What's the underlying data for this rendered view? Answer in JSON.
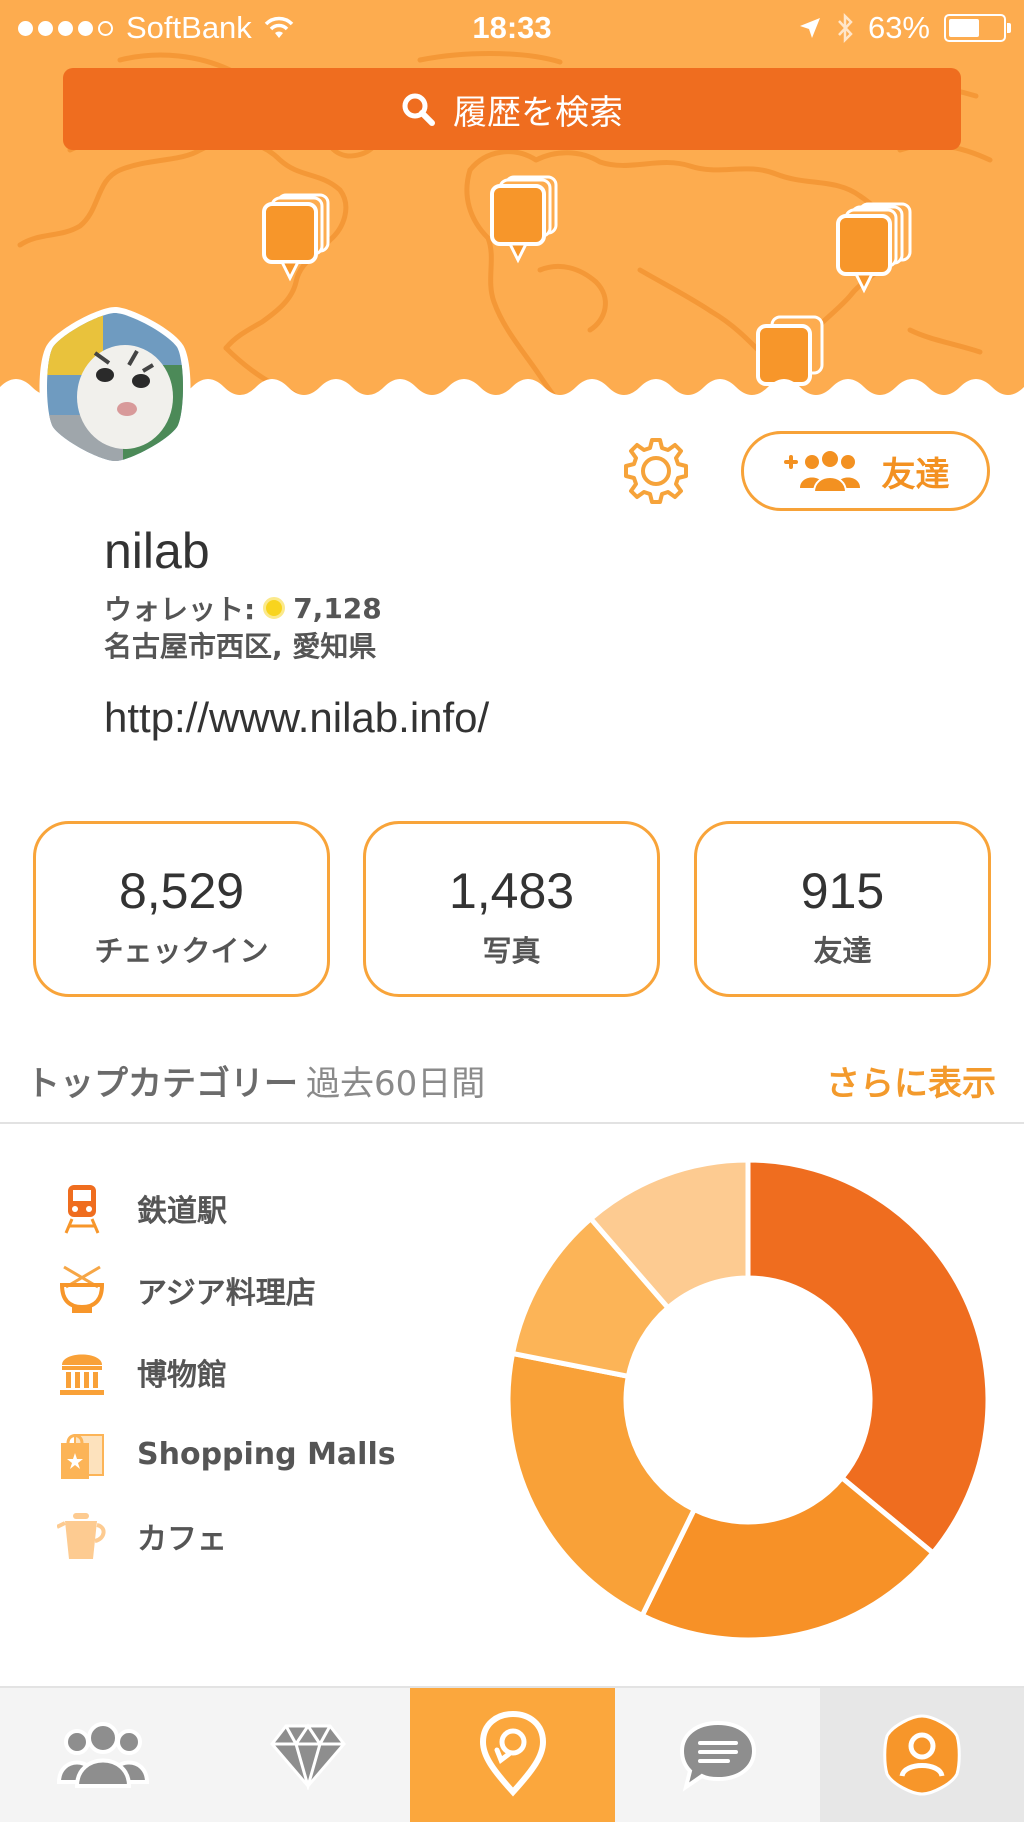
{
  "status_bar": {
    "carrier": "SoftBank",
    "time": "18:33",
    "battery": "63%",
    "battery_level": 0.63
  },
  "search": {
    "placeholder": "履歴を検索"
  },
  "profile": {
    "username": "nilab",
    "wallet_label": "ウォレット:",
    "wallet_amount": "7,128",
    "location": "名古屋市西区, 愛知県",
    "website": "http://www.nilab.info/"
  },
  "actions": {
    "friends_label": "友達"
  },
  "stats": [
    {
      "value": "8,529",
      "label": "チェックイン"
    },
    {
      "value": "1,483",
      "label": "写真"
    },
    {
      "value": "915",
      "label": "友達"
    }
  ],
  "top_categories": {
    "title": "トップカテゴリー",
    "period": "過去60日間",
    "show_more": "さらに表示",
    "items": [
      {
        "label": "鉄道駅",
        "icon": "train-icon"
      },
      {
        "label": "アジア料理店",
        "icon": "bowl-icon"
      },
      {
        "label": "博物館",
        "icon": "museum-icon"
      },
      {
        "label": "Shopping Malls",
        "icon": "shopping-bag-icon"
      },
      {
        "label": "カフェ",
        "icon": "coffee-pot-icon"
      }
    ]
  },
  "chart_data": {
    "type": "pie",
    "shares": [
      0.342,
      0.202,
      0.198,
      0.1,
      0.108
    ],
    "colors": [
      "#ef6d1f",
      "#f79127",
      "#f9a138",
      "#fcb457",
      "#fdcb91"
    ]
  },
  "tabs": [
    {
      "name": "friends-tab",
      "icon": "friends-icon"
    },
    {
      "name": "gems-tab",
      "icon": "diamond-icon"
    },
    {
      "name": "checkin-tab",
      "icon": "location-checkin-icon"
    },
    {
      "name": "messages-tab",
      "icon": "chat-icon"
    },
    {
      "name": "profile-tab",
      "icon": "profile-icon"
    }
  ],
  "colors": {
    "header": "#fdac4f",
    "search": "#ef6d1f",
    "accent": "#f39a2c"
  }
}
